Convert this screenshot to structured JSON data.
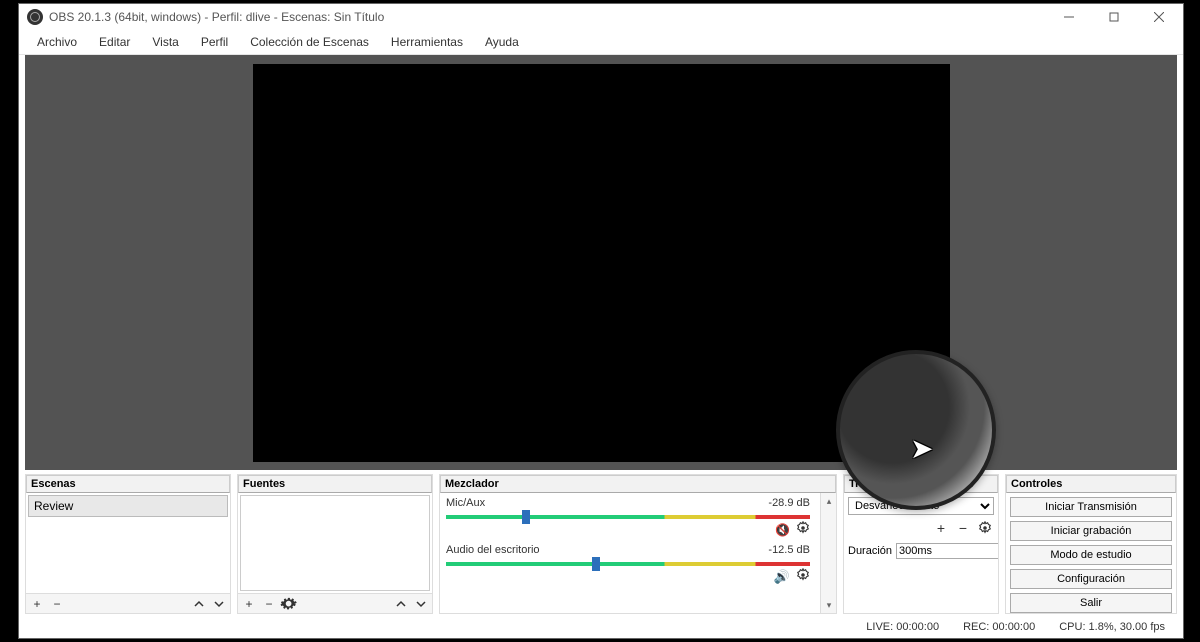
{
  "title": "OBS 20.1.3 (64bit, windows) - Perfil: dlive - Escenas: Sin Título",
  "menu": [
    "Archivo",
    "Editar",
    "Vista",
    "Perfil",
    "Colección de Escenas",
    "Herramientas",
    "Ayuda"
  ],
  "panels": {
    "scenes": {
      "title": "Escenas",
      "items": [
        "Review"
      ]
    },
    "sources": {
      "title": "Fuentes"
    },
    "mixer": {
      "title": "Mezclador",
      "channels": [
        {
          "name": "Mic/Aux",
          "level": "-28.9 dB",
          "handle_pct": 21,
          "muted": true
        },
        {
          "name": "Audio del escritorio",
          "level": "-12.5 dB",
          "handle_pct": 40,
          "muted": false
        }
      ]
    },
    "transitions": {
      "title": "Transiciones de escena",
      "selected": "Desvanecimiento",
      "duration_label": "Duración",
      "duration_value": "300ms"
    },
    "controls": {
      "title": "Controles",
      "buttons": [
        "Iniciar Transmisión",
        "Iniciar grabación",
        "Modo de estudio",
        "Configuración",
        "Salir"
      ]
    }
  },
  "status": {
    "live": "LIVE: 00:00:00",
    "rec": "REC: 00:00:00",
    "cpu": "CPU: 1.8%, 30.00 fps"
  }
}
